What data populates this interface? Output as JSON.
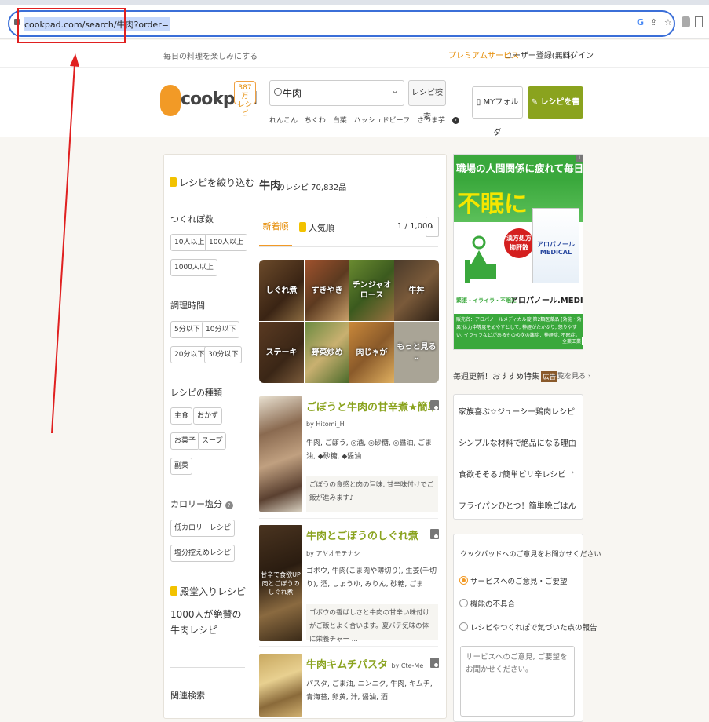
{
  "browser": {
    "url": "cookpad.com/search/牛肉?order=",
    "icons": [
      "lock-icon",
      "google-icon",
      "share-icon",
      "star-icon",
      "extension-icon",
      "profile-icon"
    ]
  },
  "topbar": {
    "tagline": "毎日の料理を楽しみにする",
    "premium": "プレミアムサービス",
    "signup": "ユーザー登録(無料)",
    "login": "ログイン"
  },
  "header": {
    "logo": "cookpad",
    "count_line1": "387万",
    "count_line2": "レシピ",
    "search_value": "牛肉",
    "search_button": "レシピ検索",
    "suggestions": [
      "れんこん",
      "ちくわ",
      "白菜",
      "ハッシュドビーフ",
      "さつま芋"
    ],
    "myfolder": "MYフォルダ",
    "write_recipe": "レシピを書く"
  },
  "sidebar": {
    "heading": "レシピを絞り込む",
    "tsukurepo_title": "つくれぽ数",
    "tsukurepo_chips": [
      "10人以上",
      "100人以上",
      "1000人以上"
    ],
    "time_title": "調理時間",
    "time_chips": [
      "5分以下",
      "10分以下",
      "20分以下",
      "30分以下"
    ],
    "type_title": "レシピの種類",
    "type_chips": [
      "主食",
      "おかず",
      "お菓子",
      "スープ",
      "副菜"
    ],
    "calorie_title": "カロリー塩分",
    "calorie_chips": [
      "低カロリーレシピ",
      "塩分控えめレシピ"
    ],
    "hall_title": "殿堂入りレシピ",
    "hall_text": "1000人が絶賛の牛肉レシピ",
    "related_title": "関連検索"
  },
  "results": {
    "keyword": "牛肉",
    "count_text": "のレシピ 70,832品",
    "tab_new": "新着順",
    "tab_popular": "人気順",
    "pager": "1 / 1,000",
    "grid": [
      "しぐれ煮",
      "すきやき",
      "チンジャオロース",
      "牛丼",
      "ステーキ",
      "野菜炒め",
      "肉じゃが",
      "もっと見る"
    ],
    "recipes": [
      {
        "title": "ごぼうと牛肉の甘辛煮★簡単",
        "author": "by Hitomi_H",
        "ingredients": "牛肉, ごぼう, ◎酒, ◎砂糖, ◎醤油, ごま油, ◆砂糖, ◆醤油",
        "description": "ごぼうの食感と肉の旨味, 甘辛味付けでご飯が進みます♪"
      },
      {
        "title": "牛肉とごぼうのしぐれ煮",
        "author": "by アヤオモテナシ",
        "ingredients": "ゴボウ, 牛肉(こま肉や薄切り), 生姜(千切り), 酒, しょうゆ, みりん, 砂糖, ごま",
        "description": "ゴボウの香ばしさと牛肉の甘辛い味付けがご飯とよく合います。夏バテ気味の体に栄養チャー ...",
        "image_text": "甘辛で食欲UP\n肉とごぼうのしぐれ煮"
      },
      {
        "title": "牛肉キムチパスタ",
        "author": "by Cte-Me",
        "ingredients": "パスタ, ごま油, ニンニク, 牛肉, キムチ, 青海苔, 卵黄, 汁, 醤油, 酒"
      }
    ]
  },
  "ad": {
    "headline1": "職場の人間関係に疲れて毎日続く",
    "headline2": "不眠に",
    "seal1": "漢方処方",
    "seal2": "抑肝散",
    "product": "アロパノール MEDICAL",
    "tagline": "緊張・イライラ・不眠に",
    "brand": "アロパノール.MEDICAL",
    "footer": "販売名：アロパノールメディカル錠 第2類医薬品 [効能・効果]体力中等度をめやすとして, 神経がたかぶり, 怒りやすい, イライラなどがあるものの次の諸症：神経症, 不眠症。",
    "maker": "全薬工業",
    "colors": {
      "green": "#3aa83c",
      "red": "#d41f1f",
      "yellow": "#f5e600"
    }
  },
  "feature": {
    "title": "毎週更新！おすすめ特集",
    "ad_tag": "広告",
    "all_link": "一覧を見る",
    "items": [
      "家族喜ぶ☆ジューシー鶏肉レシピ",
      "シンプルな材料で絶品になる理由",
      "食欲そそる♪簡単ピリ辛レシピ",
      "フライパンひとつ！簡単晩ごはん"
    ]
  },
  "feedback": {
    "title": "クックパッドへのご意見をお聞かせください",
    "options": [
      "サービスへのご意見・ご要望",
      "機能の不具合",
      "レシピやつくれぽで気づいた点の報告"
    ],
    "placeholder": "サービスへのご意見, ご要望をお聞かせください。"
  },
  "colors": {
    "accent": "#f29a26",
    "green": "#8aa31e",
    "annotation_red": "#e02020"
  }
}
